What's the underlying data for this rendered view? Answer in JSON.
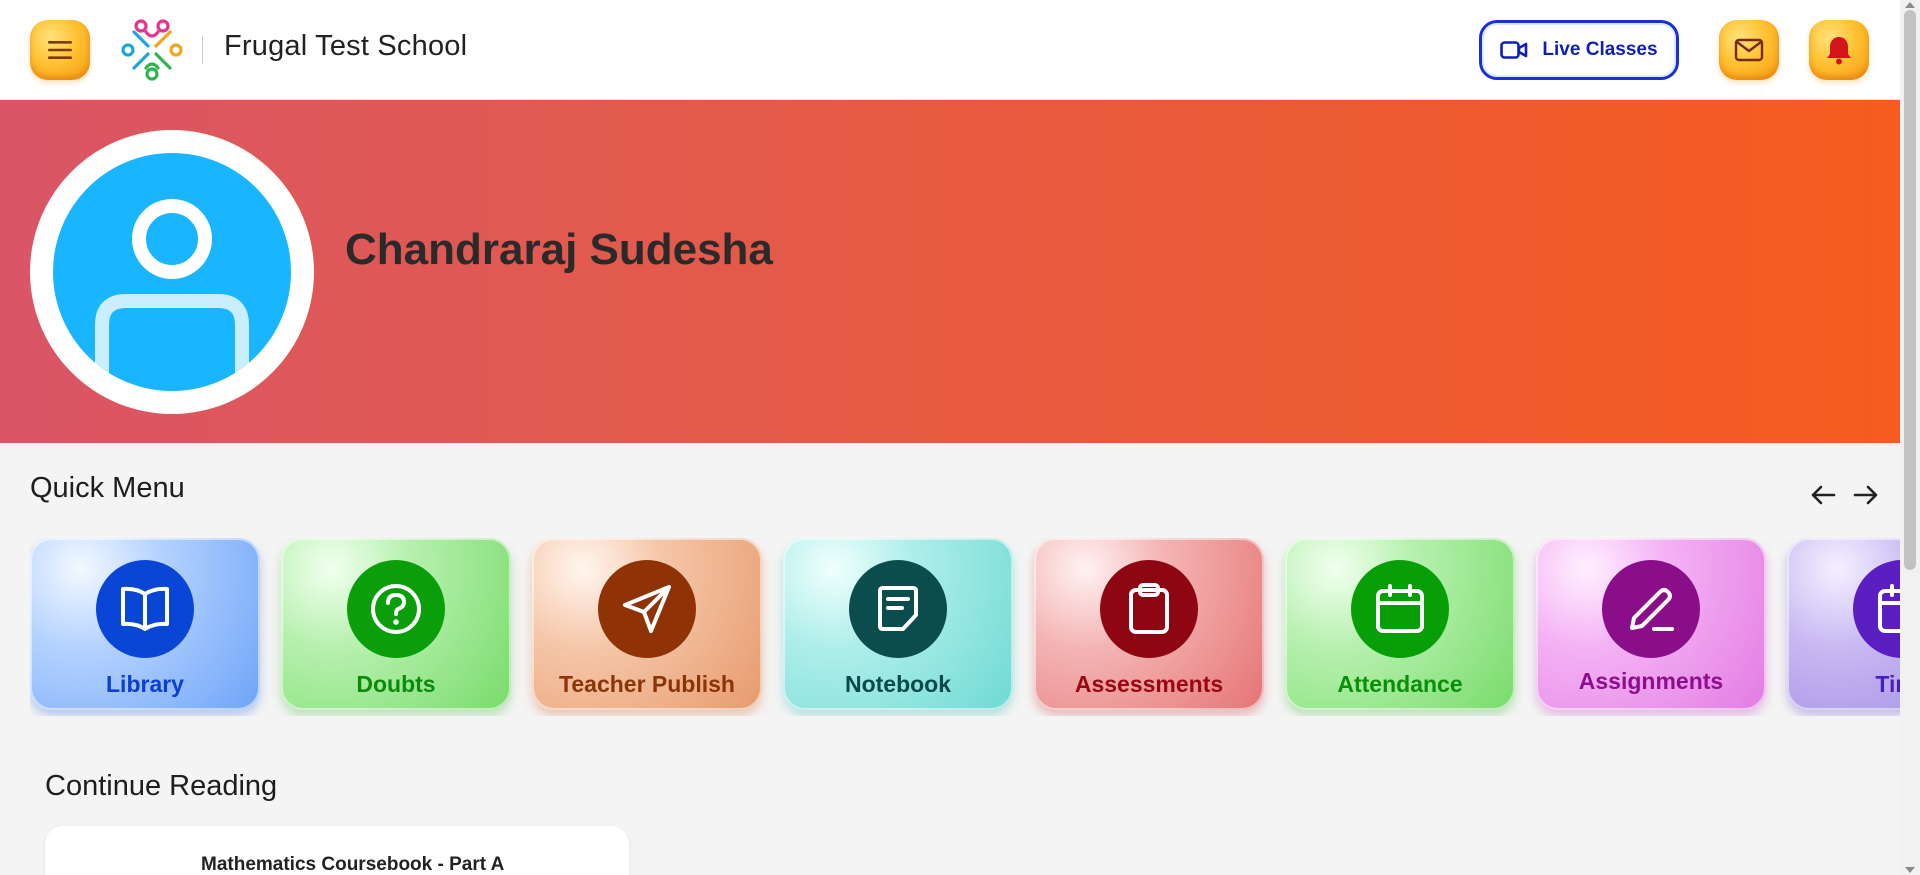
{
  "header": {
    "school_name": "Frugal Test School",
    "live_classes_label": "Live Classes",
    "icons": [
      "menu-icon",
      "school-logo",
      "video-icon",
      "mail-icon",
      "bell-icon"
    ]
  },
  "banner": {
    "user_name": "Chandraraj Sudesha"
  },
  "quick_menu": {
    "title": "Quick Menu",
    "items": [
      {
        "label": "Library",
        "icon": "book-open-icon",
        "label_color": "#0a3fcf",
        "circle_color": "#0a46d6"
      },
      {
        "label": "Doubts",
        "icon": "question-icon",
        "label_color": "#0c8a0c",
        "circle_color": "#0a9e0a"
      },
      {
        "label": "Teacher Publish",
        "icon": "send-icon",
        "label_color": "#8a3507",
        "circle_color": "#8f3306"
      },
      {
        "label": "Notebook",
        "icon": "note-icon",
        "label_color": "#0a4a4a",
        "circle_color": "#0b4d4d"
      },
      {
        "label": "Assessments",
        "icon": "clipboard-icon",
        "label_color": "#9a0712",
        "circle_color": "#8d0611"
      },
      {
        "label": "Attendance",
        "icon": "calendar-icon",
        "label_color": "#0a8f0a",
        "circle_color": "#079e07"
      },
      {
        "label": "Assignments",
        "icon": "pencil-icon",
        "label_color": "#8e0f8e",
        "circle_color": "#8a0e8a"
      },
      {
        "label": "Time",
        "icon": "calendar-icon",
        "label_color": "#4a1fb8",
        "circle_color": "#5a1ec2"
      }
    ]
  },
  "continue_reading": {
    "title": "Continue Reading",
    "book_title": "Mathematics Coursebook - Part A"
  }
}
